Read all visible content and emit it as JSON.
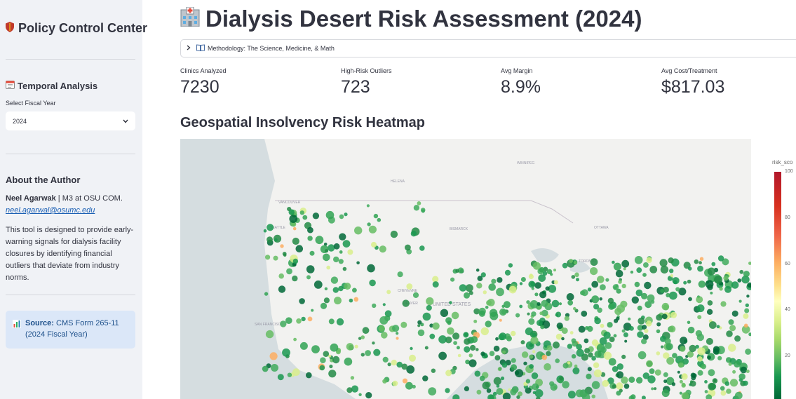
{
  "sidebar": {
    "title_icon": "shield-icon",
    "title": "Policy Control Center",
    "temporal": {
      "icon": "calendar-icon",
      "heading": "Temporal Analysis"
    },
    "year_label": "Select Fiscal Year",
    "year_value": "2024",
    "author_heading": "About the Author",
    "author_name": "Neel Agarwak",
    "author_role": " | M3 at OSU COM.",
    "author_email": "neel.agarwal@osumc.edu",
    "about_text": "This tool is designed to provide early-warning signals for dialysis facility closures by identifying financial outliers that deviate from industry norms.",
    "source_icon": "bar-chart-icon",
    "source_label": "Source:",
    "source_text": " CMS Form 265-11 (2024 Fiscal Year)"
  },
  "main": {
    "title_icon": "hospital-icon",
    "title": "Dialysis Desert Risk Assessment (2024)",
    "expander_icon": "book-icon",
    "expander_label": "Methodology: The Science, Medicine, & Math",
    "metrics": [
      {
        "label": "Clinics Analyzed",
        "value": "7230"
      },
      {
        "label": "High-Risk Outliers",
        "value": "723"
      },
      {
        "label": "Avg Margin",
        "value": "8.9%"
      },
      {
        "label": "Avg Cost/Treatment",
        "value": "$817.03"
      }
    ],
    "map_title": "Geospatial Insolvency Risk Heatmap",
    "map_labels": [
      "VANCOUVER",
      "SEATTLE",
      "WINNIPEG",
      "OTTAWA",
      "TORONTO",
      "UNITED STATES",
      "DENVER",
      "SAN FRANCISCO",
      "CHEYENNE",
      "BISMARCK",
      "HELENA"
    ],
    "colorbar": {
      "title": "risk_sco",
      "ticks": [
        "100",
        "80",
        "60",
        "40",
        "20"
      ],
      "low_color": "#006837",
      "high_color": "#b2182b"
    }
  }
}
